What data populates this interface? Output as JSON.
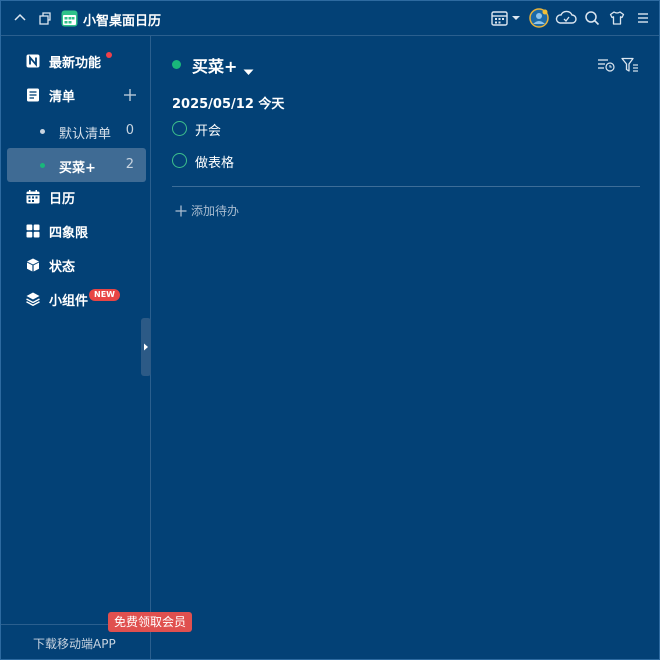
{
  "app": {
    "title": "小智桌面日历"
  },
  "sidebar": {
    "items": [
      {
        "key": "whats-new",
        "label": "最新功能"
      },
      {
        "key": "lists",
        "label": "清单"
      },
      {
        "key": "calendar",
        "label": "日历"
      },
      {
        "key": "quadrant",
        "label": "四象限"
      },
      {
        "key": "status",
        "label": "状态"
      },
      {
        "key": "widgets",
        "label": "小组件",
        "badge": "NEW"
      }
    ],
    "lists": [
      {
        "label": "默认清单",
        "count": "0",
        "dot_color": "#c8d4e0",
        "active": false
      },
      {
        "label": "买菜+",
        "count": "2",
        "dot_color": "#19b77b",
        "active": true
      }
    ],
    "footer": {
      "download": "下载移动端APP",
      "promo": "免费领取会员"
    }
  },
  "main": {
    "list_title": "买菜+",
    "list_color": "#19b77b",
    "date_heading": "2025/05/12 今天",
    "tasks": [
      {
        "label": "开会",
        "done": false
      },
      {
        "label": "做表格",
        "done": false
      }
    ],
    "add_todo": "添加待办"
  },
  "colors": {
    "background": "#034176",
    "accent_green": "#19b77b",
    "badge_red": "#e84545",
    "active_item": "#3f6b94"
  }
}
